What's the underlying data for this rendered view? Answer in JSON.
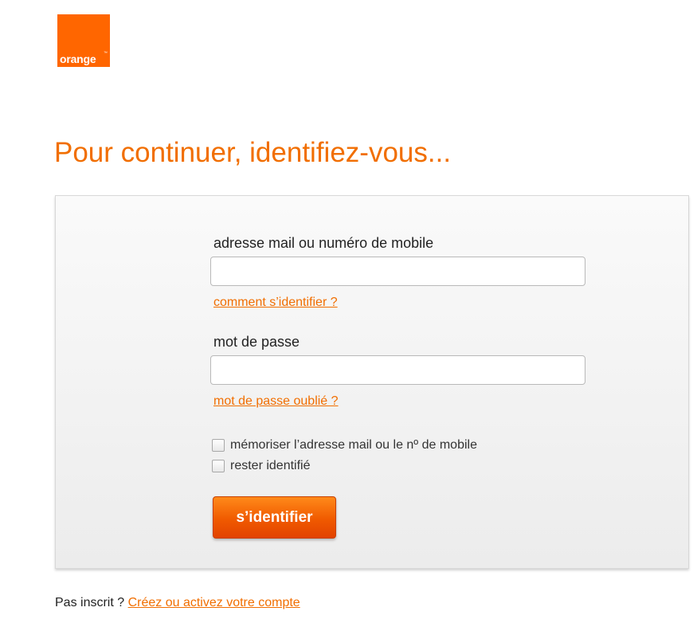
{
  "brand": {
    "logo_text": "orange",
    "logo_tm": "™",
    "color": "#ff6600"
  },
  "page_title": "Pour continuer, identifiez-vous...",
  "form": {
    "login_label": "adresse mail ou numéro de mobile",
    "login_value": "",
    "login_help_link": "comment s’identifier ?",
    "password_label": "mot de passe",
    "password_value": "",
    "password_help_link": "mot de passe oublié ?",
    "remember_login_label": "mémoriser l’adresse mail ou le nº de mobile",
    "remember_login_checked": false,
    "stay_logged_in_label": "rester identifié",
    "stay_logged_in_checked": false,
    "submit_label": "s’identifier"
  },
  "footer": {
    "prompt_text": "Pas inscrit ?",
    "create_account_link": "Créez ou activez votre compte"
  },
  "colors": {
    "accent": "#f16e00",
    "button_top": "#ff8a1a",
    "button_bottom": "#e24300"
  }
}
